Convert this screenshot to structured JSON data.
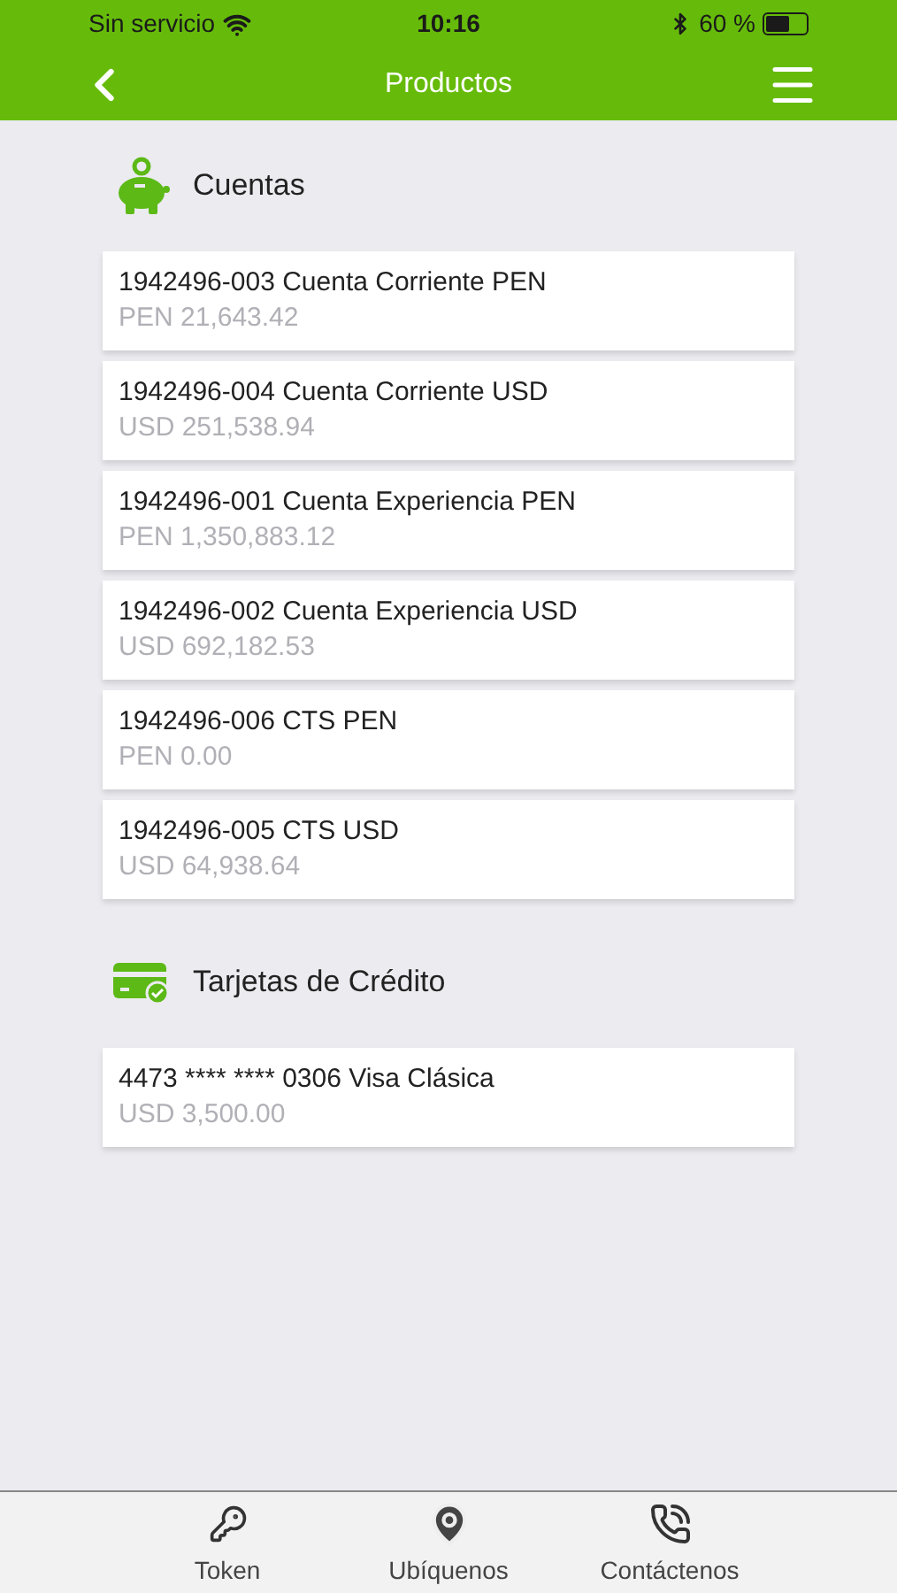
{
  "status_bar": {
    "carrier": "Sin servicio",
    "time": "10:16",
    "battery": "60 %"
  },
  "nav": {
    "title": "Productos"
  },
  "sections": [
    {
      "kind": "accounts",
      "title": "Cuentas",
      "items": [
        {
          "name": "1942496-003 Cuenta Corriente PEN",
          "amount": "PEN 21,643.42"
        },
        {
          "name": "1942496-004 Cuenta Corriente USD",
          "amount": "USD 251,538.94"
        },
        {
          "name": "1942496-001 Cuenta Experiencia PEN",
          "amount": "PEN 1,350,883.12"
        },
        {
          "name": "1942496-002 Cuenta Experiencia USD",
          "amount": "USD 692,182.53"
        },
        {
          "name": "1942496-006 CTS PEN",
          "amount": "PEN 0.00"
        },
        {
          "name": "1942496-005 CTS USD",
          "amount": "USD 64,938.64"
        }
      ]
    },
    {
      "kind": "cards",
      "title": "Tarjetas de Crédito",
      "items": [
        {
          "name": "4473 **** **** 0306 Visa Clásica",
          "amount": "USD 3,500.00"
        }
      ]
    }
  ],
  "tab_bar": [
    {
      "kind": "token",
      "label": "Token"
    },
    {
      "kind": "location",
      "label": "Ubíquenos"
    },
    {
      "kind": "phone",
      "label": "Contáctenos"
    }
  ]
}
